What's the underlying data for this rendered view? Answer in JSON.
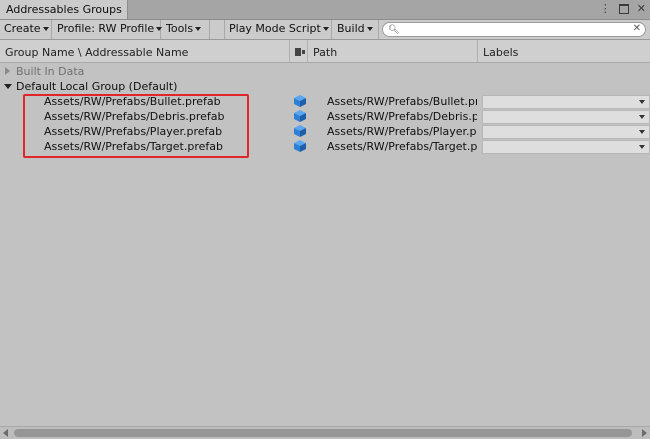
{
  "window": {
    "tab_title": "Addressables Groups"
  },
  "toolbar": {
    "create_label": "Create",
    "profile_label": "Profile: RW Profile",
    "tools_label": "Tools",
    "play_mode_label": "Play Mode Script",
    "build_label": "Build",
    "search_placeholder": ""
  },
  "columns": {
    "name": "Group Name \\ Addressable Name",
    "path": "Path",
    "labels": "Labels"
  },
  "groups": [
    {
      "name": "Built In Data",
      "expanded": false,
      "entries": []
    },
    {
      "name": "Default Local Group (Default)",
      "expanded": true,
      "entries": [
        {
          "name": "Assets/RW/Prefabs/Bullet.prefab",
          "path": "Assets/RW/Prefabs/Bullet.pr",
          "icon": "prefab-cube-icon"
        },
        {
          "name": "Assets/RW/Prefabs/Debris.prefab",
          "path": "Assets/RW/Prefabs/Debris.p",
          "icon": "prefab-cube-icon"
        },
        {
          "name": "Assets/RW/Prefabs/Player.prefab",
          "path": "Assets/RW/Prefabs/Player.p",
          "icon": "prefab-cube-icon"
        },
        {
          "name": "Assets/RW/Prefabs/Target.prefab",
          "path": "Assets/RW/Prefabs/Target.p",
          "icon": "prefab-cube-icon"
        }
      ]
    }
  ],
  "colors": {
    "highlight": "#e0262a",
    "prefab_icon": "#2f7fd6"
  }
}
